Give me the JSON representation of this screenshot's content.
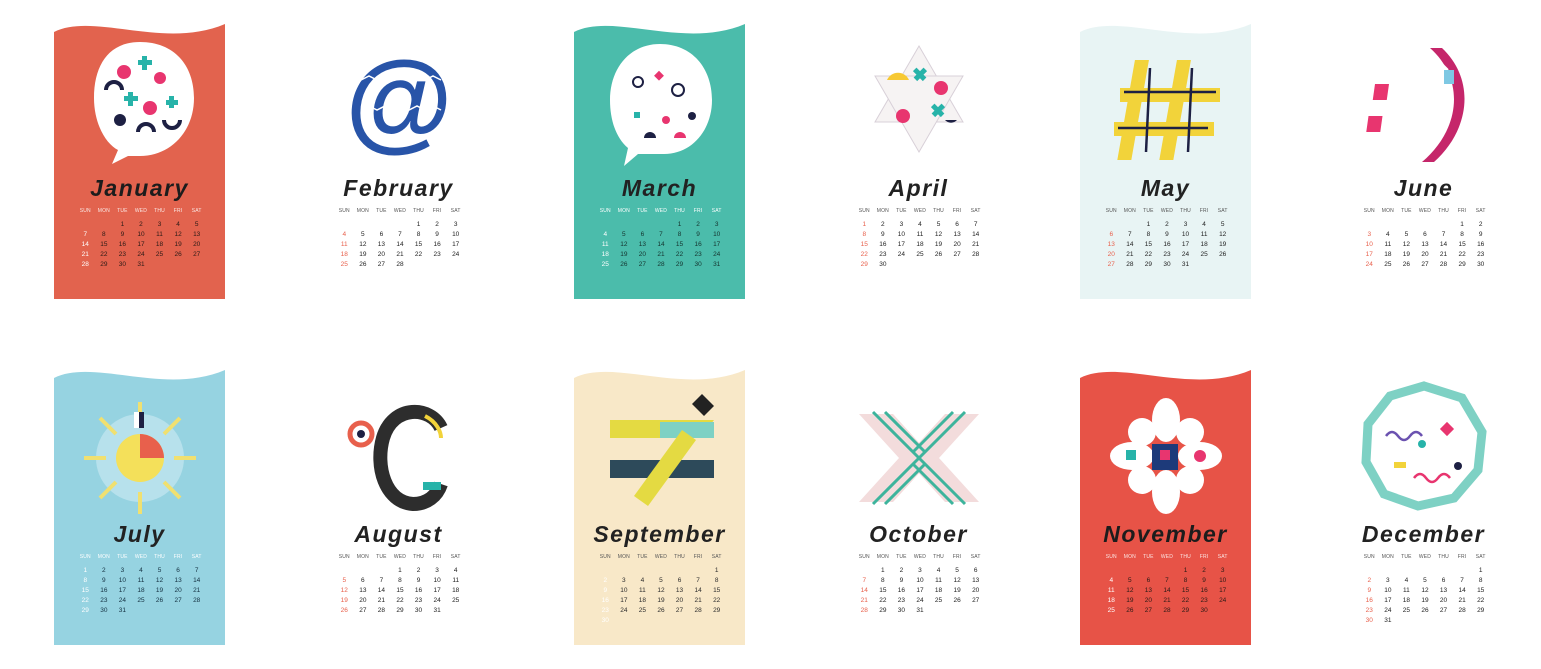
{
  "weekdays": [
    "SUN",
    "MON",
    "TUE",
    "WED",
    "THU",
    "FRI",
    "SAT"
  ],
  "months": [
    {
      "name": "January",
      "bg": "#e2634e",
      "style": "light",
      "symbol": "speech-bubble",
      "weeks": [
        [
          "",
          "",
          "1",
          "2",
          "3",
          "4",
          "5",
          "6"
        ],
        [
          "7",
          "8",
          "9",
          "10",
          "11",
          "12",
          "13"
        ],
        [
          "14",
          "15",
          "16",
          "17",
          "18",
          "19",
          "20"
        ],
        [
          "21",
          "22",
          "23",
          "24",
          "25",
          "26",
          "27"
        ],
        [
          "28",
          "29",
          "30",
          "31",
          "",
          "",
          ""
        ]
      ]
    },
    {
      "name": "February",
      "bg": "#ffffff",
      "style": "plain",
      "symbol": "at-sign",
      "weeks": [
        [
          "",
          "",
          "",
          "",
          "1",
          "2",
          "3"
        ],
        [
          "4",
          "5",
          "6",
          "7",
          "8",
          "9",
          "10"
        ],
        [
          "11",
          "12",
          "13",
          "14",
          "15",
          "16",
          "17"
        ],
        [
          "18",
          "19",
          "20",
          "21",
          "22",
          "23",
          "24"
        ],
        [
          "25",
          "26",
          "27",
          "28",
          "",
          "",
          ""
        ]
      ]
    },
    {
      "name": "March",
      "bg": "#4bbcab",
      "style": "teal",
      "symbol": "chat-bubble",
      "weeks": [
        [
          "",
          "",
          "",
          "",
          "1",
          "2",
          "3"
        ],
        [
          "4",
          "5",
          "6",
          "7",
          "8",
          "9",
          "10"
        ],
        [
          "11",
          "12",
          "13",
          "14",
          "15",
          "16",
          "17"
        ],
        [
          "18",
          "19",
          "20",
          "21",
          "22",
          "23",
          "24"
        ],
        [
          "25",
          "26",
          "27",
          "28",
          "29",
          "30",
          "31"
        ]
      ]
    },
    {
      "name": "April",
      "bg": "#ffffff",
      "style": "plain",
      "symbol": "star-of-david",
      "weeks": [
        [
          "1",
          "2",
          "3",
          "4",
          "5",
          "6",
          "7"
        ],
        [
          "8",
          "9",
          "10",
          "11",
          "12",
          "13",
          "14"
        ],
        [
          "15",
          "16",
          "17",
          "18",
          "19",
          "20",
          "21"
        ],
        [
          "22",
          "23",
          "24",
          "25",
          "26",
          "27",
          "28"
        ],
        [
          "29",
          "30",
          "",
          "",
          "",
          "",
          ""
        ]
      ]
    },
    {
      "name": "May",
      "bg": "#e8f4f4",
      "style": "mint",
      "symbol": "hash",
      "weeks": [
        [
          "",
          "",
          "1",
          "2",
          "3",
          "4",
          "5"
        ],
        [
          "6",
          "7",
          "8",
          "9",
          "10",
          "11",
          "12"
        ],
        [
          "13",
          "14",
          "15",
          "16",
          "17",
          "18",
          "19"
        ],
        [
          "20",
          "21",
          "22",
          "23",
          "24",
          "25",
          "26"
        ],
        [
          "27",
          "28",
          "29",
          "30",
          "31",
          "",
          ""
        ]
      ]
    },
    {
      "name": "June",
      "bg": "#ffffff",
      "style": "plain",
      "symbol": "smiley",
      "weeks": [
        [
          "",
          "",
          "",
          "",
          "",
          "1",
          "2"
        ],
        [
          "3",
          "4",
          "5",
          "6",
          "7",
          "8",
          "9"
        ],
        [
          "10",
          "11",
          "12",
          "13",
          "14",
          "15",
          "16"
        ],
        [
          "17",
          "18",
          "19",
          "20",
          "21",
          "22",
          "23"
        ],
        [
          "24",
          "25",
          "26",
          "27",
          "28",
          "29",
          "30"
        ]
      ]
    },
    {
      "name": "July",
      "bg": "#96d3e1",
      "style": "sky",
      "symbol": "sun",
      "weeks": [
        [
          "1",
          "2",
          "3",
          "4",
          "5",
          "6",
          "7"
        ],
        [
          "8",
          "9",
          "10",
          "11",
          "12",
          "13",
          "14"
        ],
        [
          "15",
          "16",
          "17",
          "18",
          "19",
          "20",
          "21"
        ],
        [
          "22",
          "23",
          "24",
          "25",
          "26",
          "27",
          "28"
        ],
        [
          "29",
          "30",
          "31",
          "",
          "",
          "",
          ""
        ]
      ]
    },
    {
      "name": "August",
      "bg": "#ffffff",
      "style": "plain",
      "symbol": "degree-celsius",
      "weeks": [
        [
          "",
          "",
          "",
          "1",
          "2",
          "3",
          "4"
        ],
        [
          "5",
          "6",
          "7",
          "8",
          "9",
          "10",
          "11"
        ],
        [
          "12",
          "13",
          "14",
          "15",
          "16",
          "17",
          "18"
        ],
        [
          "19",
          "20",
          "21",
          "22",
          "23",
          "24",
          "25"
        ],
        [
          "26",
          "27",
          "28",
          "29",
          "30",
          "31",
          ""
        ]
      ]
    },
    {
      "name": "September",
      "bg": "#f8e8c8",
      "style": "cream",
      "symbol": "not-equal",
      "weeks": [
        [
          "",
          "",
          "",
          "",
          "",
          "",
          "1"
        ],
        [
          "2",
          "3",
          "4",
          "5",
          "6",
          "7",
          "8"
        ],
        [
          "9",
          "10",
          "11",
          "12",
          "13",
          "14",
          "15"
        ],
        [
          "16",
          "17",
          "18",
          "19",
          "20",
          "21",
          "22"
        ],
        [
          "23",
          "24",
          "25",
          "26",
          "27",
          "28",
          "29"
        ],
        [
          "30",
          "",
          "",
          "",
          "",
          "",
          ""
        ]
      ]
    },
    {
      "name": "October",
      "bg": "#ffffff",
      "style": "plain",
      "symbol": "chevrons",
      "weeks": [
        [
          "",
          "1",
          "2",
          "3",
          "4",
          "5",
          "6"
        ],
        [
          "7",
          "8",
          "9",
          "10",
          "11",
          "12",
          "13"
        ],
        [
          "14",
          "15",
          "16",
          "17",
          "18",
          "19",
          "20"
        ],
        [
          "21",
          "22",
          "23",
          "24",
          "25",
          "26",
          "27"
        ],
        [
          "28",
          "29",
          "30",
          "31",
          "",
          "",
          ""
        ]
      ]
    },
    {
      "name": "November",
      "bg": "#e75347",
      "style": "light",
      "symbol": "flower",
      "weeks": [
        [
          "",
          "",
          "",
          "",
          "1",
          "2",
          "3"
        ],
        [
          "4",
          "5",
          "6",
          "7",
          "8",
          "9",
          "10"
        ],
        [
          "11",
          "12",
          "13",
          "14",
          "15",
          "16",
          "17"
        ],
        [
          "18",
          "19",
          "20",
          "21",
          "22",
          "23",
          "24"
        ],
        [
          "25",
          "26",
          "27",
          "28",
          "29",
          "30",
          ""
        ]
      ]
    },
    {
      "name": "December",
      "bg": "#ffffff",
      "style": "plain",
      "symbol": "polygon-badge",
      "weeks": [
        [
          "",
          "",
          "",
          "",
          "",
          "",
          "1"
        ],
        [
          "2",
          "3",
          "4",
          "5",
          "6",
          "7",
          "8"
        ],
        [
          "9",
          "10",
          "11",
          "12",
          "13",
          "14",
          "15"
        ],
        [
          "16",
          "17",
          "18",
          "19",
          "20",
          "21",
          "22"
        ],
        [
          "23",
          "24",
          "25",
          "26",
          "27",
          "28",
          "29"
        ],
        [
          "30",
          "31",
          "",
          "",
          "",
          "",
          ""
        ]
      ]
    }
  ]
}
